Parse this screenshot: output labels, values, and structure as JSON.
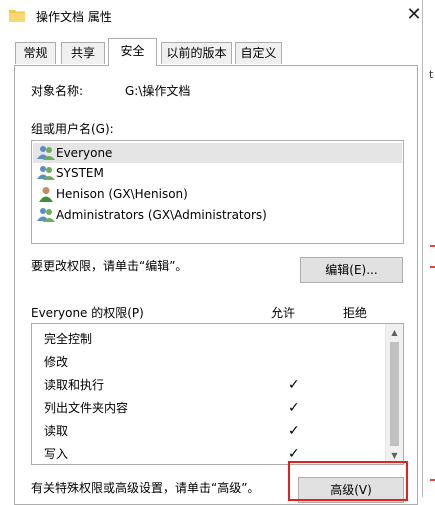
{
  "window": {
    "title": "操作文档 属性",
    "close_glyph": "✕"
  },
  "tabs": [
    {
      "label": "常规"
    },
    {
      "label": "共享"
    },
    {
      "label": "安全"
    },
    {
      "label": "以前的版本"
    },
    {
      "label": "自定义"
    }
  ],
  "object": {
    "label": "对象名称:",
    "value": "G:\\操作文档"
  },
  "groups": {
    "label": "组或用户名(G):",
    "items": [
      {
        "label": "Everyone",
        "icon": "group-users-icon"
      },
      {
        "label": "SYSTEM",
        "icon": "group-users-icon"
      },
      {
        "label": "Henison (GX\\Henison)",
        "icon": "user-icon"
      },
      {
        "label": "Administrators (GX\\Administrators)",
        "icon": "group-users-icon"
      }
    ]
  },
  "edit": {
    "hint": "要更改权限，请单击“编辑”。",
    "button": "编辑(E)..."
  },
  "permissions": {
    "title": "Everyone 的权限(P)",
    "allow_header": "允许",
    "deny_header": "拒绝",
    "rows": [
      {
        "label": "完全控制",
        "allow": ""
      },
      {
        "label": "修改",
        "allow": ""
      },
      {
        "label": "读取和执行",
        "allow": "✓"
      },
      {
        "label": "列出文件夹内容",
        "allow": "✓"
      },
      {
        "label": "读取",
        "allow": "✓"
      },
      {
        "label": "写入",
        "allow": "✓"
      }
    ]
  },
  "advanced": {
    "hint": "有关特殊权限或高级设置，请单击“高级”。",
    "button": "高级(V)"
  },
  "right_strip": {
    "char": "t"
  },
  "colors": {
    "highlight": "#e52020",
    "selection": "#e5e5e5"
  }
}
